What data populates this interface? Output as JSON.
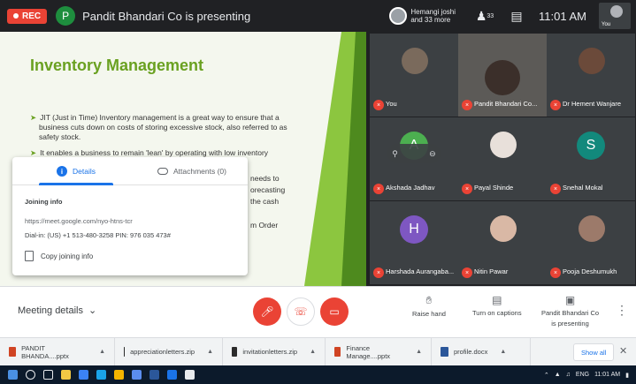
{
  "topbar": {
    "rec_label": "REC",
    "presenter_initial": "P",
    "presenting_text": "Pandit Bhandari Co is presenting",
    "people_line1": "Hemangi joshi",
    "people_line2": "and 33 more",
    "people_count": "33",
    "time": "11:01 AM",
    "self_label": "You"
  },
  "slide": {
    "title": "Inventory Management",
    "bullet1_line1": "JIT (Just in Time) Inventory management is a great way to ensure that a",
    "bullet1_line2": "business cuts down on costs of storing excessive stock, also referred to as",
    "bullet1_line3": "safety stock.",
    "bullet2_line1": "It enables a business to remain 'lean' by operating with low inventory",
    "frag1": "needs to",
    "frag2": "orecasting",
    "frag3": "the cash",
    "frag4": "m Order"
  },
  "details_popup": {
    "tab_details": "Details",
    "tab_attachments": "Attachments (0)",
    "joining_info": "Joining info",
    "meet_link": "https://meet.google.com/nyo-htns-tcr",
    "dial_in": "Dial-in: (US) +1 513-480-3258  PIN: 976 035 473#",
    "copy_label": "Copy joining info"
  },
  "participants": [
    {
      "name": "You",
      "initial": "",
      "color": "#7a6a5c"
    },
    {
      "name": "Pandit Bhandari Co...",
      "initial": "",
      "color": "#3b2f2a"
    },
    {
      "name": "Dr Hement Wanjare",
      "initial": "",
      "color": "#6b4a3a"
    },
    {
      "name": "Akshada Jadhav",
      "initial": "A",
      "color": "#4caf50"
    },
    {
      "name": "Payal Shinde",
      "initial": "",
      "color": "#e8e0da"
    },
    {
      "name": "Snehal Mokal",
      "initial": "S",
      "color": "#12897c"
    },
    {
      "name": "Harshada Aurangaba...",
      "initial": "H",
      "color": "#7e57c2"
    },
    {
      "name": "Nitin Pawar",
      "initial": "",
      "color": "#d9b8a5"
    },
    {
      "name": "Pooja Deshumukh",
      "initial": "",
      "color": "#9c7a6a"
    }
  ],
  "meetbar": {
    "meeting_details": "Meeting details",
    "raise_hand": "Raise hand",
    "captions": "Turn on captions",
    "presenting_line1": "Pandit Bhandari Co",
    "presenting_line2": "is presenting"
  },
  "downloads": [
    {
      "name": "PANDIT BHANDA....pptx",
      "color": "#d04423"
    },
    {
      "name": "appreciationletters.zip",
      "color": "#2b2b2b"
    },
    {
      "name": "invitationletters.zip",
      "color": "#2b2b2b"
    },
    {
      "name": "Finance Manage....pptx",
      "color": "#d04423"
    },
    {
      "name": "profile.docx",
      "color": "#2b579a"
    }
  ],
  "download_show_all": "Show all",
  "taskbar": {
    "tray_lang": "ENG",
    "tray_time": "11:01 AM"
  },
  "colors": {
    "meet_red": "#ea4335",
    "accent_blue": "#1a73e8",
    "slide_green": "#6aa121"
  }
}
